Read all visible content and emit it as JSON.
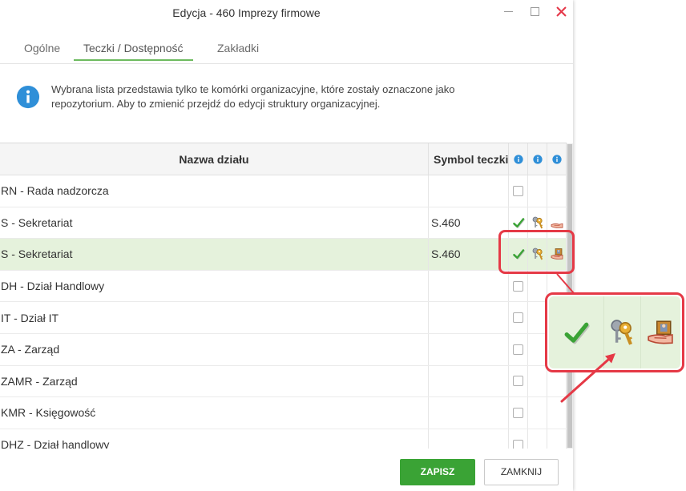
{
  "window": {
    "title": "Edycja - 460 Imprezy firmowe",
    "controls": [
      "minimize-icon",
      "maximize-icon",
      "close-icon"
    ]
  },
  "tabs": [
    {
      "label": "Ogólne",
      "active": false
    },
    {
      "label": "Teczki / Dostępność",
      "active": true
    },
    {
      "label": "Zakładki",
      "active": false
    }
  ],
  "info": {
    "icon": "info-icon",
    "lines": [
      "Wybrana lista przedstawia tylko te komórki organizacyjne, które zostały oznaczone jako",
      "repozytorium. Aby to zmienić przejdź do edycji struktury organizacyjnej."
    ]
  },
  "table": {
    "headers": {
      "name": "Nazwa działu",
      "symbol": "Symbol teczki",
      "icon_columns": [
        "info-icon",
        "info-icon",
        "info-icon"
      ]
    },
    "rows": [
      {
        "name": "RN - Rada nadzorcza",
        "symbol": "",
        "access": "checkbox",
        "checked": false,
        "selected": false
      },
      {
        "name": "S - Sekretariat",
        "symbol": "S.460",
        "access": "icons",
        "icons": [
          "check-icon",
          "keys-icon",
          "hand-icon"
        ],
        "selected": false
      },
      {
        "name": "S - Sekretariat",
        "symbol": "S.460",
        "access": "icons",
        "icons": [
          "check-icon",
          "keys-icon",
          "hand-folder-icon"
        ],
        "selected": true
      },
      {
        "name": "DH - Dział Handlowy",
        "symbol": "",
        "access": "checkbox",
        "checked": false,
        "selected": false
      },
      {
        "name": "IT - Dział IT",
        "symbol": "",
        "access": "checkbox",
        "checked": false,
        "selected": false
      },
      {
        "name": "ZA - Zarząd",
        "symbol": "",
        "access": "checkbox",
        "checked": false,
        "selected": false
      },
      {
        "name": "ZAMR - Zarząd",
        "symbol": "",
        "access": "checkbox",
        "checked": false,
        "selected": false
      },
      {
        "name": "KMR - Księgowość",
        "symbol": "",
        "access": "checkbox",
        "checked": false,
        "selected": false
      },
      {
        "name": "DHZ - Dział handlowy",
        "symbol": "",
        "access": "checkbox",
        "checked": false,
        "selected": false
      }
    ]
  },
  "buttons": {
    "save": "ZAPISZ",
    "close": "ZAMKNIJ"
  },
  "callout": {
    "icons": [
      "check-icon",
      "keys-icon",
      "hand-folder-icon"
    ]
  },
  "colors": {
    "accent": "#3aa335",
    "selected_row": "#e5f2dc",
    "annotation": "#e53946",
    "info": "#2f8fd8",
    "close": "#e5394a"
  }
}
